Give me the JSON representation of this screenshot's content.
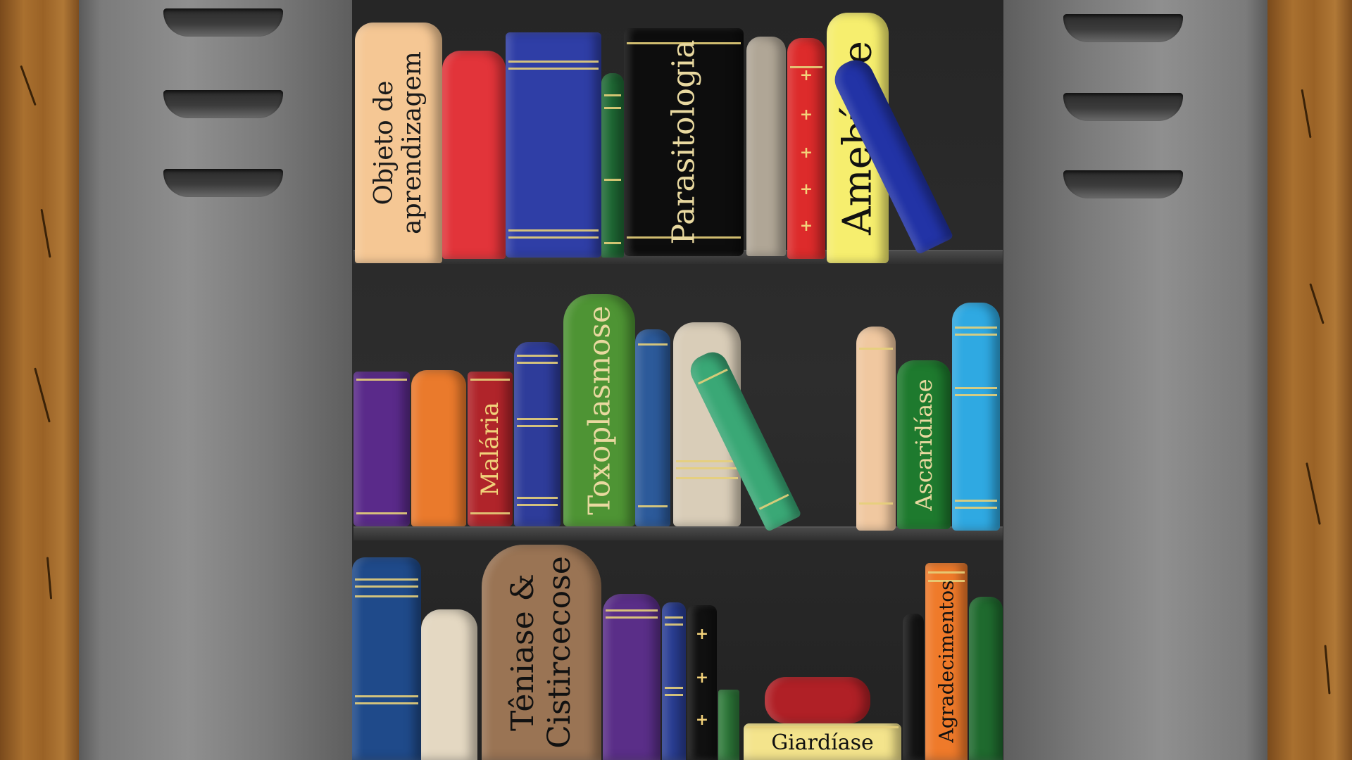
{
  "books": {
    "objeto": {
      "line1": "Objeto de",
      "line2": "aprendizagem"
    },
    "parasitologia": "Parasitologia",
    "amebiase": "Amebíase",
    "malaria": "Malária",
    "toxoplasmose": "Toxoplasmose",
    "ascaridiase": "Ascaridíase",
    "teniase": {
      "line1": "Têniase &",
      "line2": "Cistircecose"
    },
    "giardiase": "Giardíase",
    "agradecimentos": "Agradecimentos"
  },
  "colors": {
    "wood": "#9a6226",
    "locker": "#7b7b7b",
    "interior": "#262626",
    "gold": "#e6cf7a"
  }
}
